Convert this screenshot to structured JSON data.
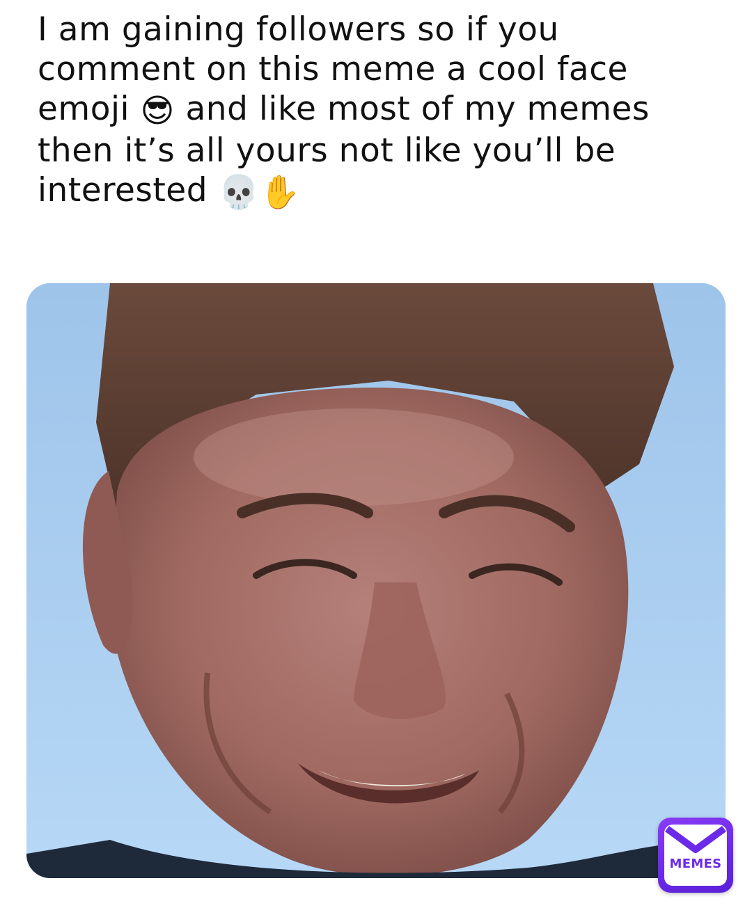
{
  "caption": {
    "text_part1": "I am gaining followers so if you comment on this meme a cool face emoji",
    "emoji1": "😎",
    "text_part2": "and like most of my memes then it’s all yours not like you’ll be interested",
    "emoji2": "💀✋"
  },
  "watermark": {
    "label": "MEMES",
    "color": "#6b2ae8"
  },
  "photo": {
    "icon": "smiling-man-photo",
    "background_color": "#a9cdee"
  }
}
